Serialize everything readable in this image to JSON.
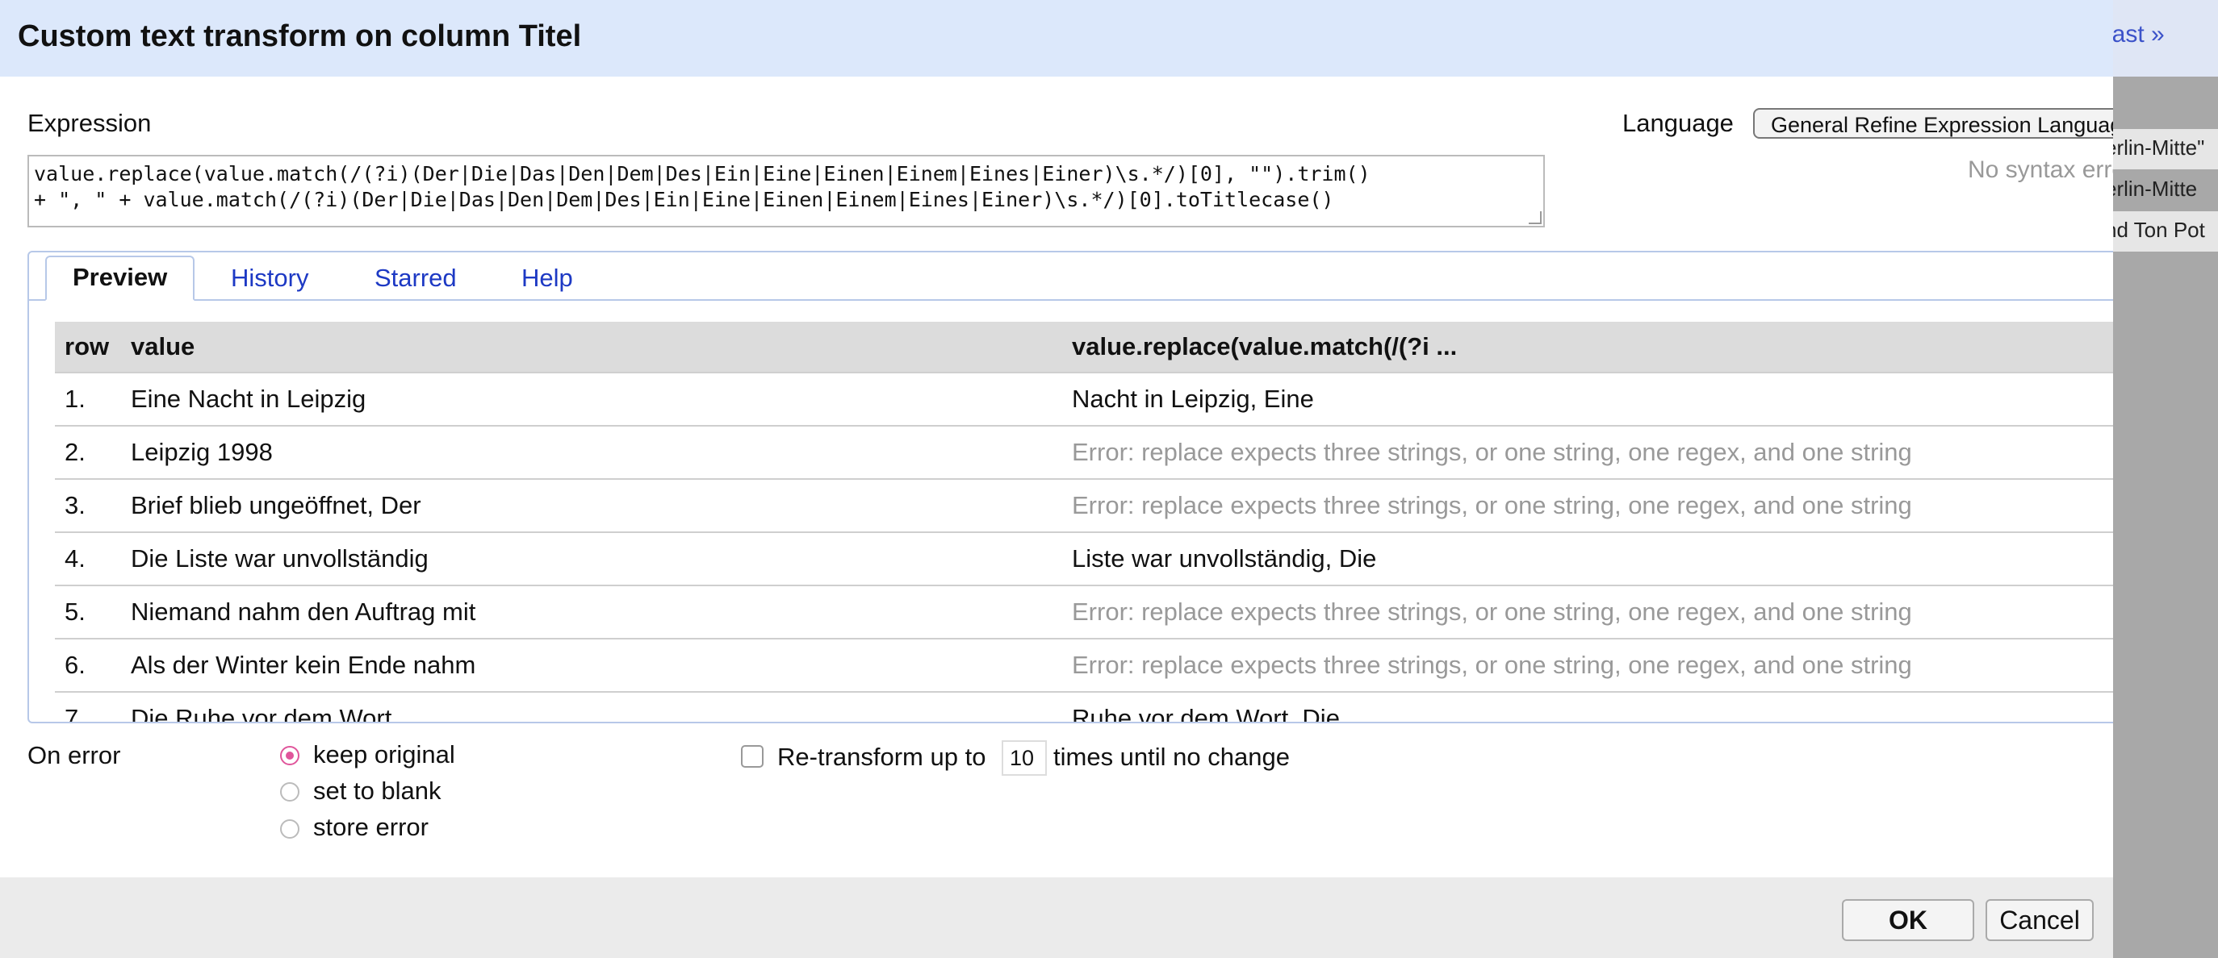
{
  "background": {
    "link": "last »",
    "cells": [
      "erlin-Mitte\"",
      "erlin-Mitte",
      "nd Ton Pot"
    ]
  },
  "dialog": {
    "title": "Custom text transform on column Titel",
    "expression_label": "Expression",
    "language_label": "Language",
    "language_value": "General Refine Expression Language (GREL)",
    "syntax_status": "No syntax error.",
    "expression_lines": [
      "value.replace(value.match(/(?i)(Der|Die|Das|Den|Dem|Des|Ein|Eine|Einen|Einem|Eines|Einer)\\s.*/)[0], \"\").trim()",
      "+ \", \" + value.match(/(?i)(Der|Die|Das|Den|Dem|Des|Ein|Eine|Einen|Einem|Eines|Einer)\\s.*/)[0].toTitlecase()"
    ],
    "tabs": [
      "Preview",
      "History",
      "Starred",
      "Help"
    ],
    "preview": {
      "headers": [
        "row",
        "value",
        "value.replace(value.match(/(?i ..."
      ],
      "rows": [
        {
          "row": "1.",
          "value": "Eine Nacht in Leipzig",
          "result": "Nacht in Leipzig, Eine",
          "error": false
        },
        {
          "row": "2.",
          "value": "Leipzig 1998",
          "result": "Error: replace expects three strings, or one string, one regex, and one string",
          "error": true
        },
        {
          "row": "3.",
          "value": "Brief blieb ungeöffnet, Der",
          "result": "Error: replace expects three strings, or one string, one regex, and one string",
          "error": true
        },
        {
          "row": "4.",
          "value": "Die Liste war unvollständig",
          "result": "Liste war unvollständig, Die",
          "error": false
        },
        {
          "row": "5.",
          "value": "Niemand nahm den Auftrag mit",
          "result": "Error: replace expects three strings, or one string, one regex, and one string",
          "error": true
        },
        {
          "row": "6.",
          "value": "Als der Winter kein Ende nahm",
          "result": "Error: replace expects three strings, or one string, one regex, and one string",
          "error": true
        },
        {
          "row": "7.",
          "value": "Die Ruhe vor dem Wort",
          "result": "Ruhe vor dem Wort, Die",
          "error": false
        }
      ]
    },
    "on_error": {
      "label": "On error",
      "options": [
        "keep original",
        "set to blank",
        "store error"
      ],
      "selected": "keep original"
    },
    "retransform": {
      "label_before": "Re-transform up to",
      "times": "10",
      "label_after": "times until no change",
      "checked": false
    },
    "buttons": {
      "ok": "OK",
      "cancel": "Cancel"
    },
    "colors": {
      "title_bg": "#dce8fb",
      "tab_link": "#1d39c4",
      "radio_accent": "#e0559b",
      "error_text": "#999999"
    }
  }
}
